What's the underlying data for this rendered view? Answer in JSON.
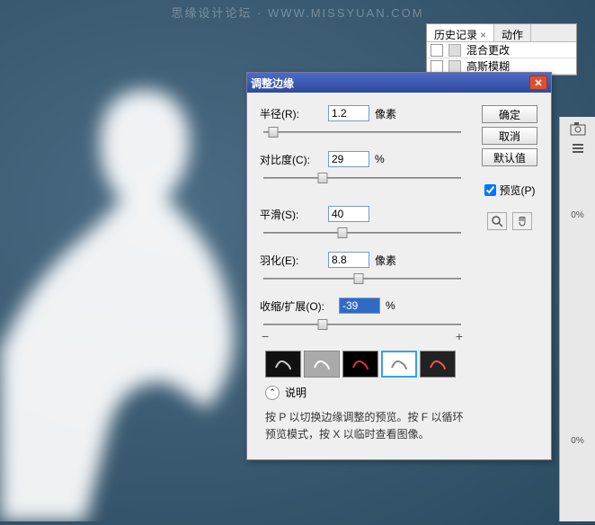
{
  "watermark": "思缘设计论坛 · WWW.MISSYUAN.COM",
  "history": {
    "tabs": [
      {
        "label": "历史记录",
        "active": true
      },
      {
        "label": "动作",
        "active": false
      }
    ],
    "items": [
      {
        "label": "混合更改"
      },
      {
        "label": "高斯模糊"
      }
    ]
  },
  "dialog": {
    "title": "调整边缘",
    "buttons": {
      "ok": "确定",
      "cancel": "取消",
      "default": "默认值"
    },
    "preview_label": "预览(P)",
    "fields": {
      "radius": {
        "label": "半径(R):",
        "value": "1.2",
        "unit": "像素",
        "pos": 5
      },
      "contrast": {
        "label": "对比度(C):",
        "value": "29",
        "unit": "%",
        "pos": 30
      },
      "smooth": {
        "label": "平滑(S):",
        "value": "40",
        "unit": "",
        "pos": 40
      },
      "feather": {
        "label": "羽化(E):",
        "value": "8.8",
        "unit": "像素",
        "pos": 48
      },
      "expand": {
        "label": "收缩/扩展(O):",
        "value": "-39",
        "unit": "%",
        "pos": 30
      }
    },
    "desc_title": "说明",
    "desc_text": "按 P 以切换边缘调整的预览。按 F 以循环预览模式，按 X 以临时查看图像。"
  },
  "side_pct": "0%"
}
